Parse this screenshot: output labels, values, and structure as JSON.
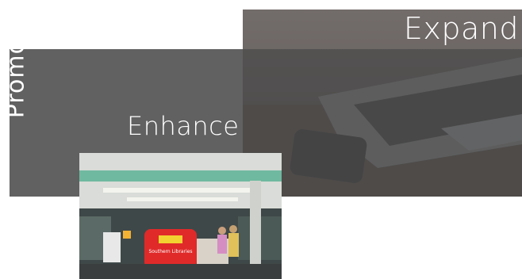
{
  "labels": {
    "expand": "Expand",
    "enhance": "Enhance",
    "promote": "Promote"
  },
  "library_photo": {
    "desk_sign": "Southern Libraries"
  },
  "colors": {
    "band": "#616161",
    "text": "#ffffff",
    "desk": "#e02a2a"
  }
}
